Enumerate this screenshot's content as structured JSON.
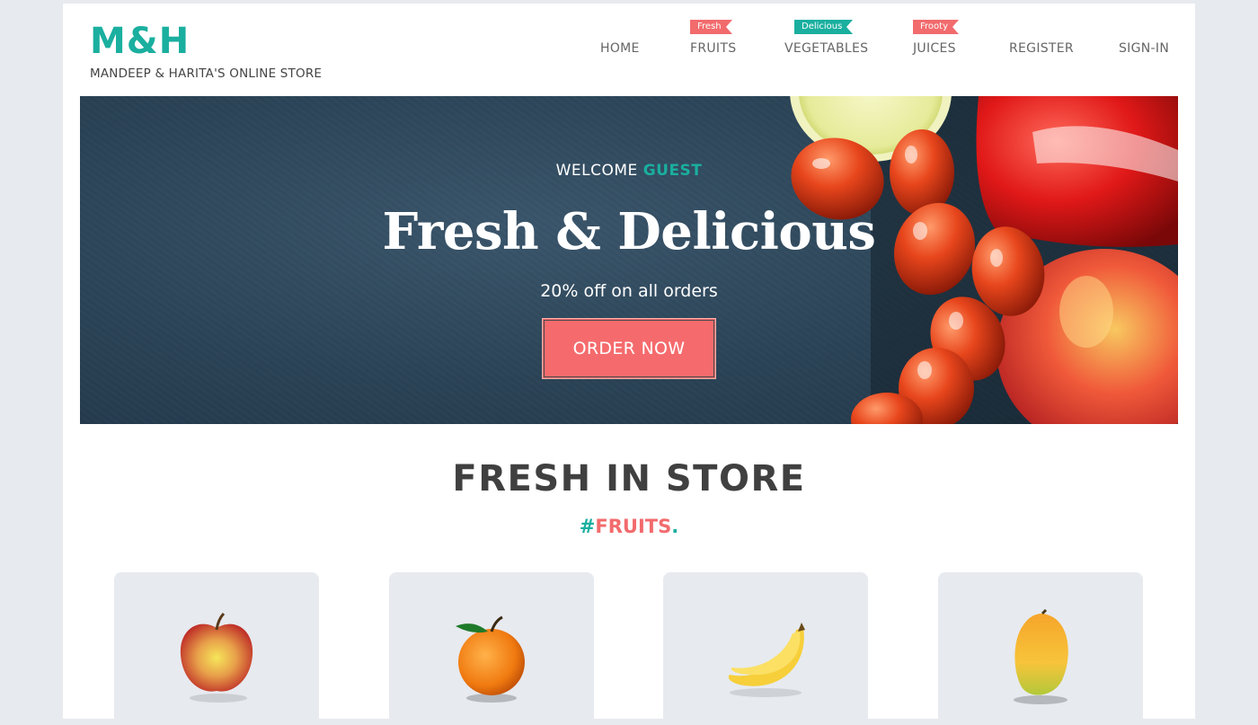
{
  "brand": {
    "name": "M&H",
    "tagline": "MANDEEP & HARITA'S ONLINE STORE"
  },
  "nav": {
    "items": [
      {
        "label": "HOME"
      },
      {
        "label": "FRUITS",
        "tag": "Fresh"
      },
      {
        "label": "VEGETABLES",
        "tag": "Delicious"
      },
      {
        "label": "JUICES",
        "tag": "Frooty"
      },
      {
        "label": "REGISTER"
      },
      {
        "label": "SIGN-IN"
      }
    ]
  },
  "hero": {
    "welcome": "WELCOME",
    "user": "GUEST",
    "title": "Fresh & Delicious",
    "subtitle": "20% off on all orders",
    "cta": "ORDER NOW"
  },
  "section": {
    "title": "FRESH IN STORE",
    "hash": "#",
    "category": "FRUITS",
    "dot": "."
  },
  "products": [
    {
      "icon": "apple-icon"
    },
    {
      "icon": "orange-icon"
    },
    {
      "icon": "banana-icon"
    },
    {
      "icon": "mango-icon"
    }
  ],
  "colors": {
    "accent": "#1aaf9f",
    "highlight": "#f26b6d",
    "background": "#e7eaef",
    "hero": "#2b4356"
  }
}
